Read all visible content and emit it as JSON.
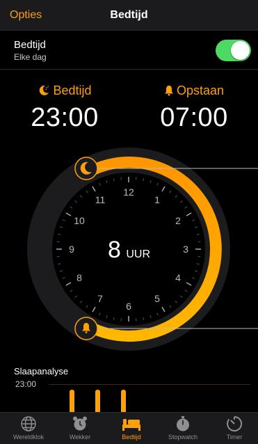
{
  "navbar": {
    "left_label": "Opties",
    "title": "Bedtijd"
  },
  "schedule": {
    "title": "Bedtijd",
    "subtitle": "Elke dag",
    "enabled": true
  },
  "bedtime": {
    "label": "Bedtijd",
    "time": "23:00",
    "icon": "moon-icon"
  },
  "wake": {
    "label": "Opstaan",
    "time": "07:00",
    "icon": "bell-icon"
  },
  "dial": {
    "duration_value": "8",
    "duration_unit": "UUR",
    "hours": [
      "12",
      "1",
      "2",
      "3",
      "4",
      "5",
      "6",
      "7",
      "8",
      "9",
      "10",
      "11"
    ]
  },
  "analysis": {
    "title": "Slaapanalyse",
    "time_label": "23:00",
    "bars": 3
  },
  "tabs": [
    {
      "label": "Wereldklok",
      "icon": "globe-icon",
      "active": false
    },
    {
      "label": "Wekker",
      "icon": "alarm-clock-icon",
      "active": false
    },
    {
      "label": "Bedtijd",
      "icon": "bed-icon",
      "active": true
    },
    {
      "label": "Stopwatch",
      "icon": "stopwatch-icon",
      "active": false
    },
    {
      "label": "Timer",
      "icon": "timer-icon",
      "active": false
    }
  ],
  "colors": {
    "accent": "#ff9f0a",
    "switch_on": "#4cd964",
    "background": "#000000"
  }
}
